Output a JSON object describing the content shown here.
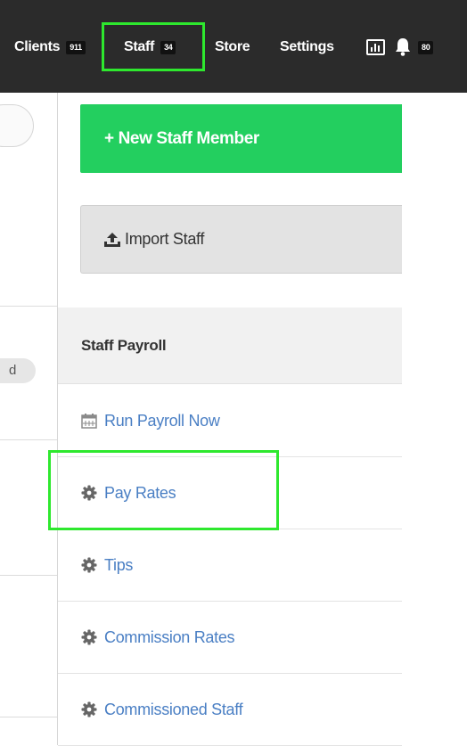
{
  "nav": {
    "items": [
      {
        "label": "Clients",
        "badge": "911"
      },
      {
        "label": "Staff",
        "badge": "34"
      },
      {
        "label": "Store"
      },
      {
        "label": "Settings"
      }
    ],
    "notifications_badge": "80"
  },
  "left_panel": {
    "pill_text": "d"
  },
  "actions": {
    "new_staff_label": "+ New Staff Member",
    "import_staff_label": "Import Staff"
  },
  "payroll": {
    "heading": "Staff Payroll",
    "items": [
      {
        "label": "Run Payroll Now",
        "icon": "calendar-icon"
      },
      {
        "label": "Pay Rates",
        "icon": "gear-icon"
      },
      {
        "label": "Tips",
        "icon": "gear-icon"
      },
      {
        "label": "Commission Rates",
        "icon": "gear-icon"
      },
      {
        "label": "Commissioned Staff",
        "icon": "gear-icon"
      }
    ]
  },
  "colors": {
    "topbar": "#2b2b2b",
    "highlight": "#2ee82e",
    "primary_button": "#23cf5f",
    "link": "#4a7fc4"
  }
}
